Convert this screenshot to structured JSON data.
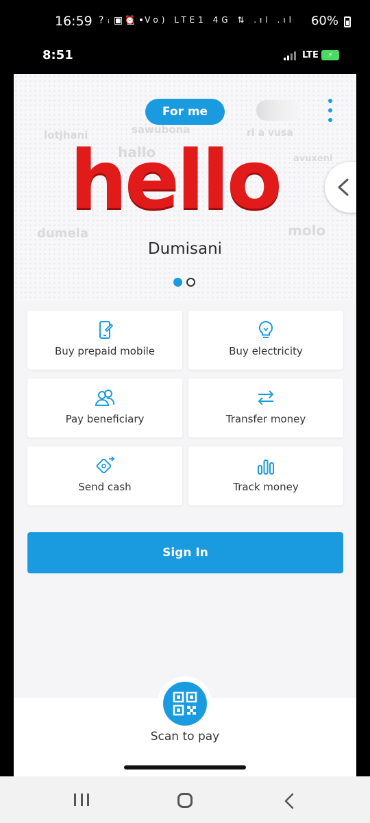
{
  "system_status": {
    "time": "16:59",
    "left_icons": "?ᵢ▣◬•",
    "right_icons": "⏰ Vo) LTE1 4G ⇅ .ıl .ıl",
    "battery_percent": "60%"
  },
  "device_status": {
    "time": "8:51",
    "network": "LTE"
  },
  "header": {
    "segment_label": "For me",
    "menu_icon": "kebab-menu-icon"
  },
  "hero": {
    "headline": "hello",
    "user_name": "Dumisani",
    "greetings": [
      "lotjhani",
      "sawubona",
      "hallo",
      "ri a vusa",
      "avuxeni",
      "dumela",
      "molo"
    ],
    "carousel_pages": 2,
    "carousel_active": 1
  },
  "tiles": [
    {
      "label": "Buy prepaid mobile",
      "icon": "phone-edit-icon"
    },
    {
      "label": "Buy electricity",
      "icon": "lightbulb-icon"
    },
    {
      "label": "Pay beneficiary",
      "icon": "people-icon"
    },
    {
      "label": "Transfer money",
      "icon": "transfer-arrows-icon"
    },
    {
      "label": "Send cash",
      "icon": "send-cash-icon"
    },
    {
      "label": "Track money",
      "icon": "bar-chart-icon"
    }
  ],
  "sign_in_label": "Sign In",
  "scan": {
    "label": "Scan to pay",
    "icon": "qr-code-icon"
  },
  "colors": {
    "primary": "#1a9be0",
    "hello_red": "#e11a1a"
  }
}
